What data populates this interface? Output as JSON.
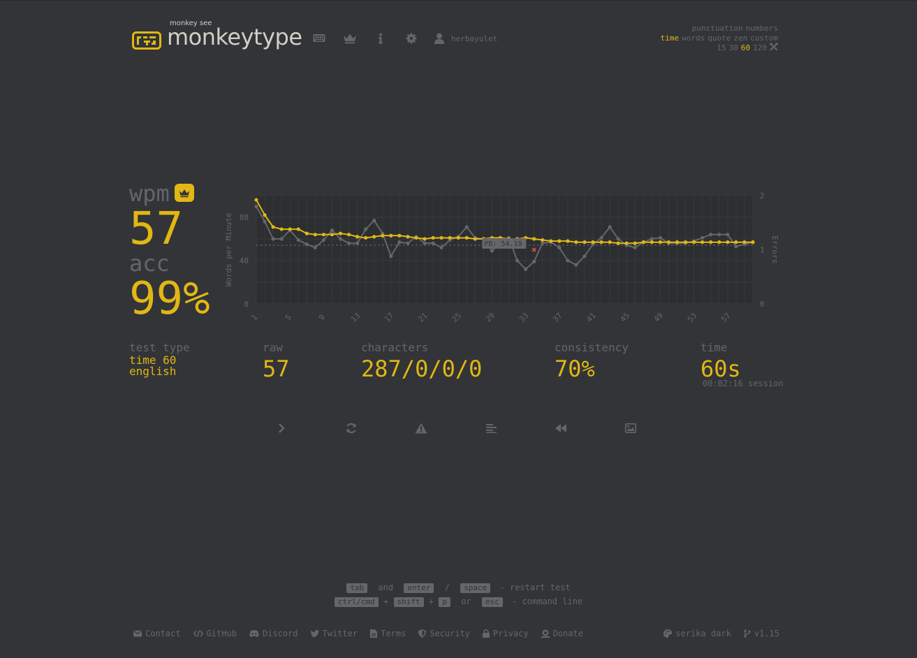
{
  "header": {
    "logo_sub": "monkey see",
    "logo_text": "monkeytype",
    "username": "herbayulet",
    "nav_icons": [
      "keyboard-icon",
      "crown-icon",
      "info-icon",
      "gear-icon",
      "user-icon"
    ]
  },
  "config": {
    "row1": [
      "punctuation",
      "numbers"
    ],
    "row2": [
      "time",
      "words",
      "quote",
      "zen",
      "custom"
    ],
    "row2_active": "time",
    "row3": [
      "15",
      "30",
      "60",
      "120"
    ],
    "row3_active": "60"
  },
  "result": {
    "wpm_label": "wpm",
    "wpm": "57",
    "acc_label": "acc",
    "acc": "99%",
    "test_type_label": "test type",
    "test_type_line1": "time 60",
    "test_type_line2": "english",
    "raw_label": "raw",
    "raw": "57",
    "characters_label": "characters",
    "characters": "287/0/0/0",
    "consistency_label": "consistency",
    "consistency": "70%",
    "time_label": "time",
    "time": "60s",
    "session": "00:02:16 session"
  },
  "chart_data": {
    "type": "line",
    "ylabel": "Words per Minute",
    "y2label": "Errors",
    "x": [
      1,
      2,
      3,
      4,
      5,
      6,
      7,
      8,
      9,
      10,
      11,
      12,
      13,
      14,
      15,
      16,
      17,
      18,
      19,
      20,
      21,
      22,
      23,
      24,
      25,
      26,
      27,
      28,
      29,
      30,
      31,
      32,
      33,
      34,
      35,
      36,
      37,
      38,
      39,
      40,
      41,
      42,
      43,
      44,
      45,
      46,
      47,
      48,
      49,
      50,
      51,
      52,
      53,
      54,
      55,
      56,
      57,
      58,
      59,
      60
    ],
    "x_ticks": [
      "1",
      "5",
      "9",
      "13",
      "17",
      "21",
      "25",
      "29",
      "33",
      "37",
      "41",
      "45",
      "49",
      "53",
      "57"
    ],
    "y_ticks": [
      "0",
      "40",
      "80"
    ],
    "y2_ticks": [
      "0",
      "1",
      "2"
    ],
    "ylim": [
      0,
      100
    ],
    "y2lim": [
      0,
      2
    ],
    "series": [
      {
        "values": [
          96,
          82,
          71,
          69,
          69,
          69,
          65,
          64,
          64,
          64,
          65,
          64,
          62,
          61,
          62,
          63,
          63,
          63,
          62,
          61,
          60,
          61,
          61,
          61,
          61,
          61,
          60,
          60,
          61,
          61,
          60,
          60,
          61,
          60,
          59,
          58,
          58,
          58,
          57,
          57,
          57,
          57,
          57,
          56,
          56,
          56,
          57,
          57,
          57,
          57,
          57,
          57,
          57,
          57,
          57,
          57,
          57,
          57,
          57,
          57
        ]
      },
      {
        "values": [
          90,
          76,
          60,
          60,
          68,
          59,
          55,
          52,
          59,
          68,
          60,
          56,
          56,
          69,
          77,
          65,
          44,
          57,
          56,
          62,
          56,
          56,
          52,
          59,
          62,
          71,
          61,
          60,
          49,
          56,
          61,
          40,
          32,
          39,
          56,
          57,
          52,
          40,
          36,
          44,
          55,
          61,
          71,
          60,
          54,
          52,
          57,
          60,
          61,
          56,
          56,
          56,
          58,
          61,
          64,
          64,
          64,
          53,
          55,
          57
        ]
      }
    ],
    "errors": [
      {
        "x": 34,
        "count": 1
      }
    ],
    "pb_line": {
      "value": 54.19,
      "label": "PB: 54.19"
    }
  },
  "hints": {
    "line1": [
      "tab",
      "and",
      "enter",
      "/",
      "space",
      "- restart test"
    ],
    "line2": [
      "ctrl/cmd",
      "+",
      "shift",
      "+",
      "p",
      "or",
      "esc",
      "- command line"
    ]
  },
  "footer": {
    "links": [
      "Contact",
      "GitHub",
      "Discord",
      "Twitter",
      "Terms",
      "Security",
      "Privacy",
      "Donate"
    ],
    "theme": "serika dark",
    "version": "v1.15"
  },
  "colors": {
    "bg": "#323437",
    "main": "#e2b714",
    "sub": "#646669",
    "text": "#d1d0c5",
    "error": "#ca4754"
  }
}
